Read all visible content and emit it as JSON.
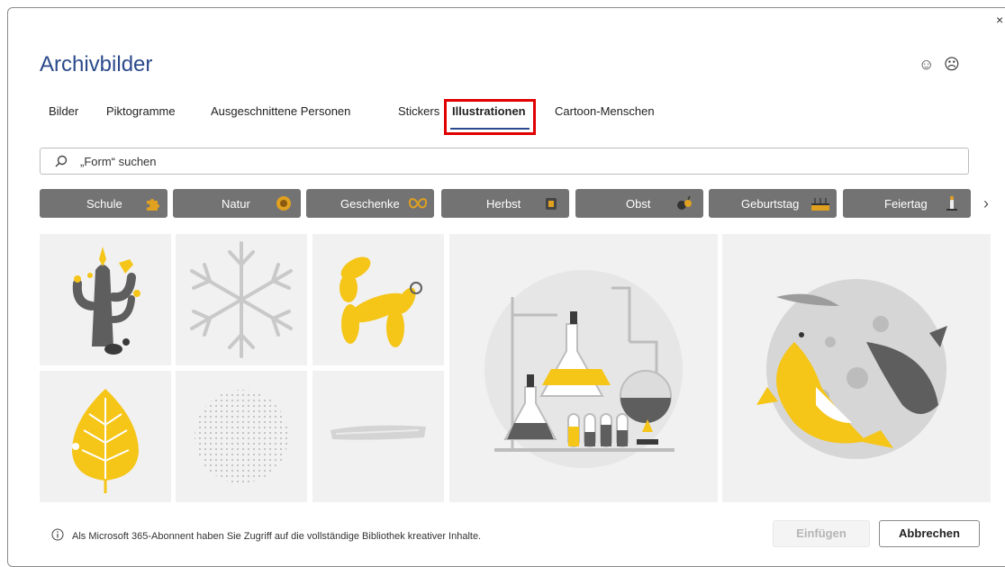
{
  "dialog": {
    "title": "Archivbilder",
    "close_glyph": "×",
    "feedback": {
      "happy_icon": "☺",
      "sad_icon": "☹"
    }
  },
  "tabs": [
    {
      "label": "Bilder"
    },
    {
      "label": "Piktogramme"
    },
    {
      "label": "Ausgeschnittene Personen"
    },
    {
      "label": "Stickers"
    },
    {
      "label": "Illustrationen",
      "active": true
    },
    {
      "label": "Cartoon-Menschen"
    }
  ],
  "search": {
    "value": "„Form“ suchen",
    "icon": "search-icon"
  },
  "chips": [
    {
      "label": "Schule",
      "icon": "puzzle-icon"
    },
    {
      "label": "Natur",
      "icon": "sunflower-icon"
    },
    {
      "label": "Geschenke",
      "icon": "bow-icon"
    },
    {
      "label": "Herbst",
      "icon": "lantern-icon"
    },
    {
      "label": "Obst",
      "icon": "fruit-icon"
    },
    {
      "label": "Geburtstag",
      "icon": "cake-icon"
    },
    {
      "label": "Feiertag",
      "icon": "candle-icon"
    }
  ],
  "tiles": [
    {
      "name": "cactus-illustration"
    },
    {
      "name": "snowflake-illustration"
    },
    {
      "name": "balloon-dog-illustration"
    },
    {
      "name": "laboratory-illustration"
    },
    {
      "name": "koi-fish-illustration"
    },
    {
      "name": "leaf-illustration"
    },
    {
      "name": "dotted-circle-illustration"
    },
    {
      "name": "brush-stroke-illustration"
    }
  ],
  "footer": {
    "info_text": "Als Microsoft 365-Abonnent haben Sie Zugriff auf die vollständige Bibliothek kreativer Inhalte.",
    "insert_label": "Einfügen",
    "cancel_label": "Abbrechen"
  },
  "colors": {
    "accent": "#2b4a8c",
    "highlight_box": "#e00000",
    "chip_bg": "#737373",
    "illustration_yellow": "#f5c518",
    "illustration_gray": "#5e5e5e",
    "tile_bg": "#f1f1f1"
  }
}
